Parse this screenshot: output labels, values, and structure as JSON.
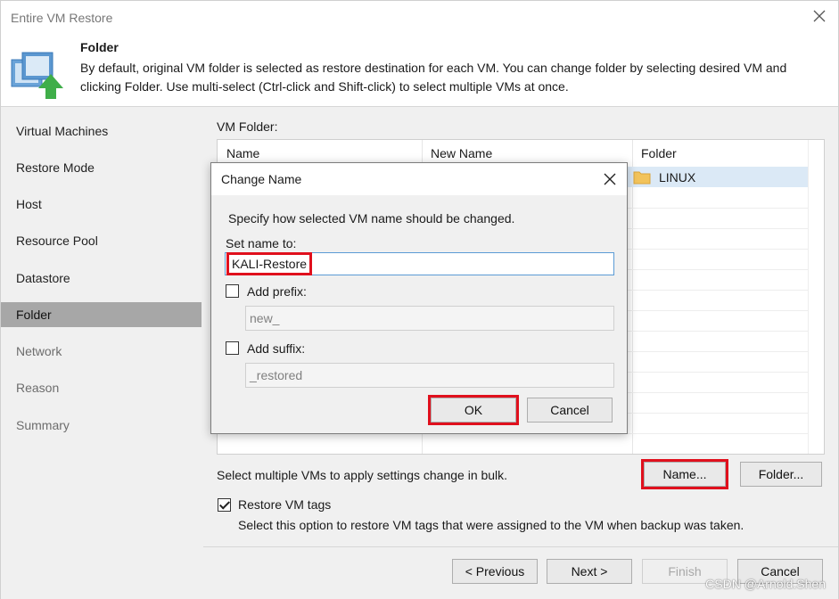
{
  "window": {
    "title": "Entire VM Restore"
  },
  "header": {
    "title": "Folder",
    "description": "By default, original VM folder is selected as restore destination for each VM. You can change folder by selecting desired VM and clicking Folder. Use multi-select (Ctrl-click and Shift-click) to select multiple VMs at once."
  },
  "sidebar": {
    "items": [
      {
        "label": "Virtual Machines"
      },
      {
        "label": "Restore Mode"
      },
      {
        "label": "Host"
      },
      {
        "label": "Resource Pool"
      },
      {
        "label": "Datastore"
      },
      {
        "label": "Folder"
      },
      {
        "label": "Network"
      },
      {
        "label": "Reason"
      },
      {
        "label": "Summary"
      }
    ]
  },
  "main": {
    "vm_folder_label": "VM Folder:",
    "columns": [
      "Name",
      "New Name",
      "Folder"
    ],
    "row": {
      "folder": "LINUX"
    },
    "bulk_text": "Select multiple VMs to apply settings change in bulk.",
    "name_button": "Name...",
    "folder_button": "Folder...",
    "restore_tags_label": "Restore VM tags",
    "restore_tags_checked": true,
    "restore_tags_desc": "Select this option to restore VM tags that were assigned to the VM when backup was taken."
  },
  "footer": {
    "previous": "< Previous",
    "next": "Next >",
    "finish": "Finish",
    "cancel": "Cancel"
  },
  "dialog": {
    "title": "Change Name",
    "description": "Specify how selected VM name should be changed.",
    "set_name_label": "Set name to:",
    "set_name_value": "KALI-Restore",
    "prefix_label": "Add prefix:",
    "prefix_value": "new_",
    "suffix_label": "Add suffix:",
    "suffix_value": "_restored",
    "ok": "OK",
    "cancel": "Cancel"
  },
  "watermark": "CSDN @Arnold.Shen",
  "colors": {
    "highlight": "#e0101d",
    "selection": "#dbe9f6",
    "active_nav": "#a7a7a7"
  }
}
